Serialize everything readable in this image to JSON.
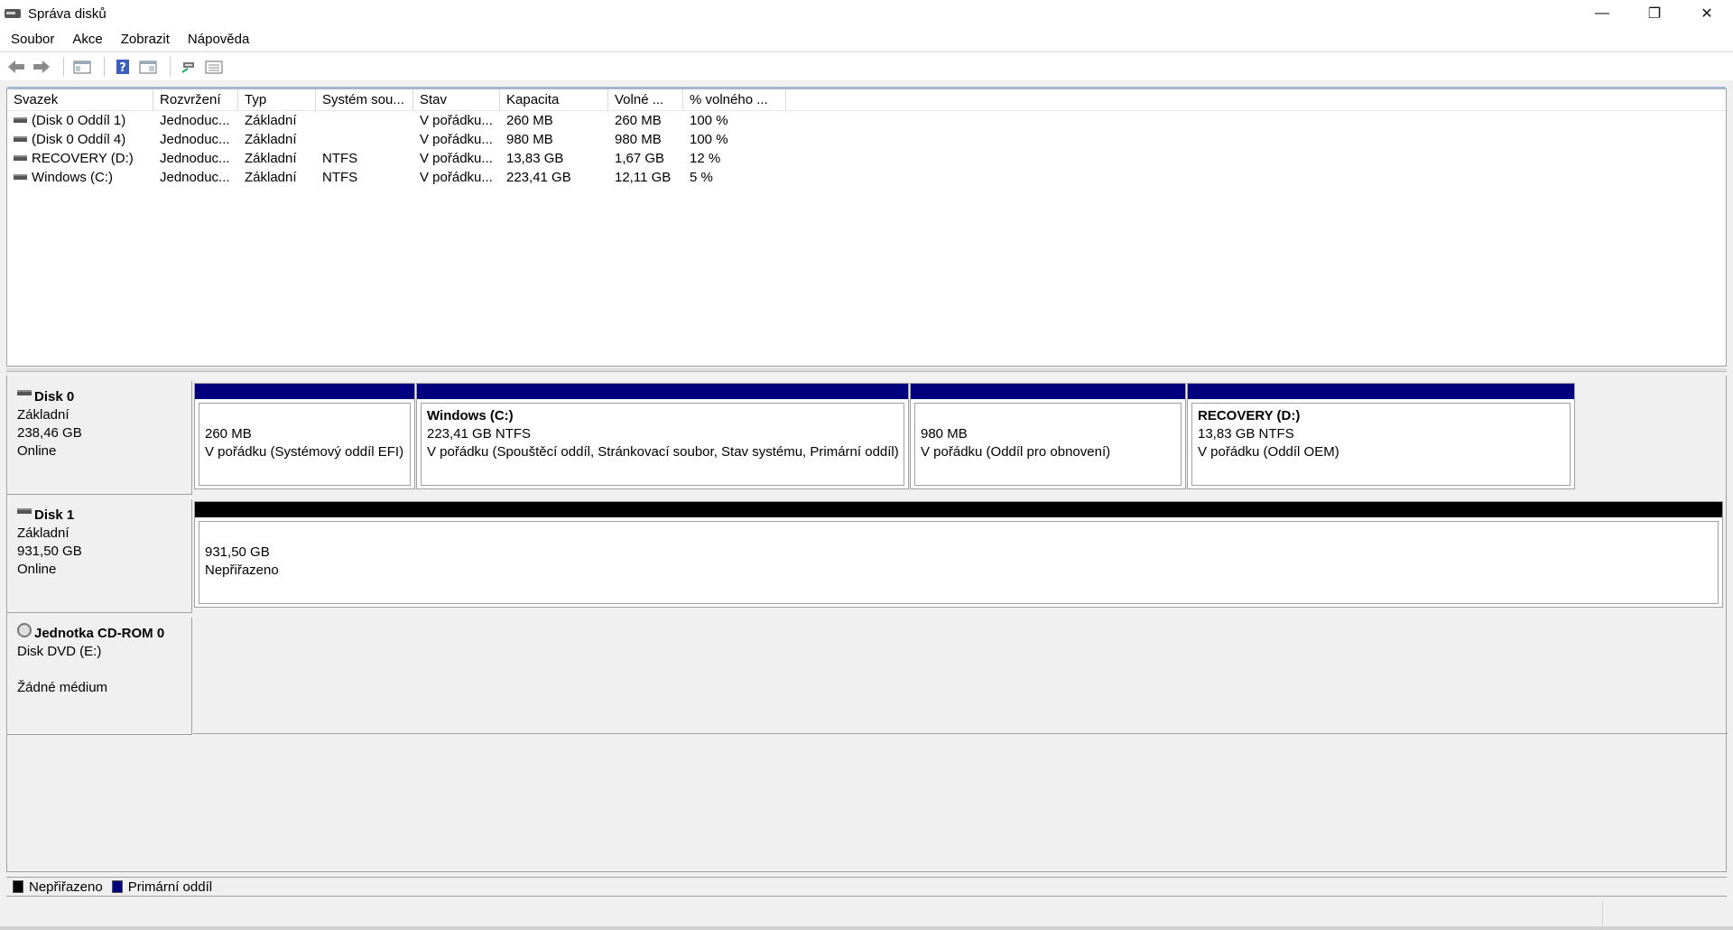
{
  "window": {
    "title": "Správa disků",
    "controls": {
      "minimize": "—",
      "restore": "❐",
      "close": "✕"
    }
  },
  "menu": [
    "Soubor",
    "Akce",
    "Zobrazit",
    "Nápověda"
  ],
  "toolbar": {
    "buttons": [
      "back-arrow-icon",
      "forward-arrow-icon",
      "console-tree-icon",
      "help-icon",
      "properties-icon",
      "connect-icon",
      "list-view-icon"
    ]
  },
  "volumes": {
    "columns": [
      "Svazek",
      "Rozvržení",
      "Typ",
      "Systém sou...",
      "Stav",
      "Kapacita",
      "Volné ...",
      "% volného ..."
    ],
    "rows": [
      [
        "(Disk 0 Oddíl 1)",
        "Jednoduc...",
        "Základní",
        "",
        "V pořádku...",
        "260 MB",
        "260 MB",
        "100 %"
      ],
      [
        "(Disk 0 Oddíl 4)",
        "Jednoduc...",
        "Základní",
        "",
        "V pořádku...",
        "980 MB",
        "980 MB",
        "100 %"
      ],
      [
        "RECOVERY (D:)",
        "Jednoduc...",
        "Základní",
        "NTFS",
        "V pořádku...",
        "13,83 GB",
        "1,67 GB",
        "12 %"
      ],
      [
        "Windows (C:)",
        "Jednoduc...",
        "Základní",
        "NTFS",
        "V pořádku...",
        "223,41 GB",
        "12,11 GB",
        "5 %"
      ]
    ]
  },
  "disks": [
    {
      "name": "Disk 0",
      "type": "Základní",
      "size": "238,46 GB",
      "status": "Online",
      "partitions": [
        {
          "name": "",
          "size": "260 MB",
          "status": "V pořádku (Systémový oddíl EFI)"
        },
        {
          "name": "Windows  (C:)",
          "size": "223,41 GB NTFS",
          "status": "V pořádku (Spouštěcí oddíl, Stránkovací soubor, Stav systému, Primární oddíl)"
        },
        {
          "name": "",
          "size": "980 MB",
          "status": "V pořádku (Oddíl pro obnovení)"
        },
        {
          "name": "RECOVERY  (D:)",
          "size": "13,83 GB NTFS",
          "status": "V pořádku (Oddíl OEM)"
        }
      ]
    },
    {
      "name": "Disk 1",
      "type": "Základní",
      "size": "931,50 GB",
      "status": "Online",
      "partitions": [
        {
          "size": "931,50 GB",
          "status": "Nepřiřazeno"
        }
      ]
    },
    {
      "name": "Jednotka CD-ROM 0",
      "type": "Disk DVD (E:)",
      "status": "Žádné médium"
    }
  ],
  "legend": [
    {
      "label": "Nepřiřazeno",
      "color": "#000000"
    },
    {
      "label": "Primární oddíl",
      "color": "#00007f"
    }
  ],
  "colors": {
    "primary_partition": "#00007f",
    "unallocated": "#000000"
  }
}
